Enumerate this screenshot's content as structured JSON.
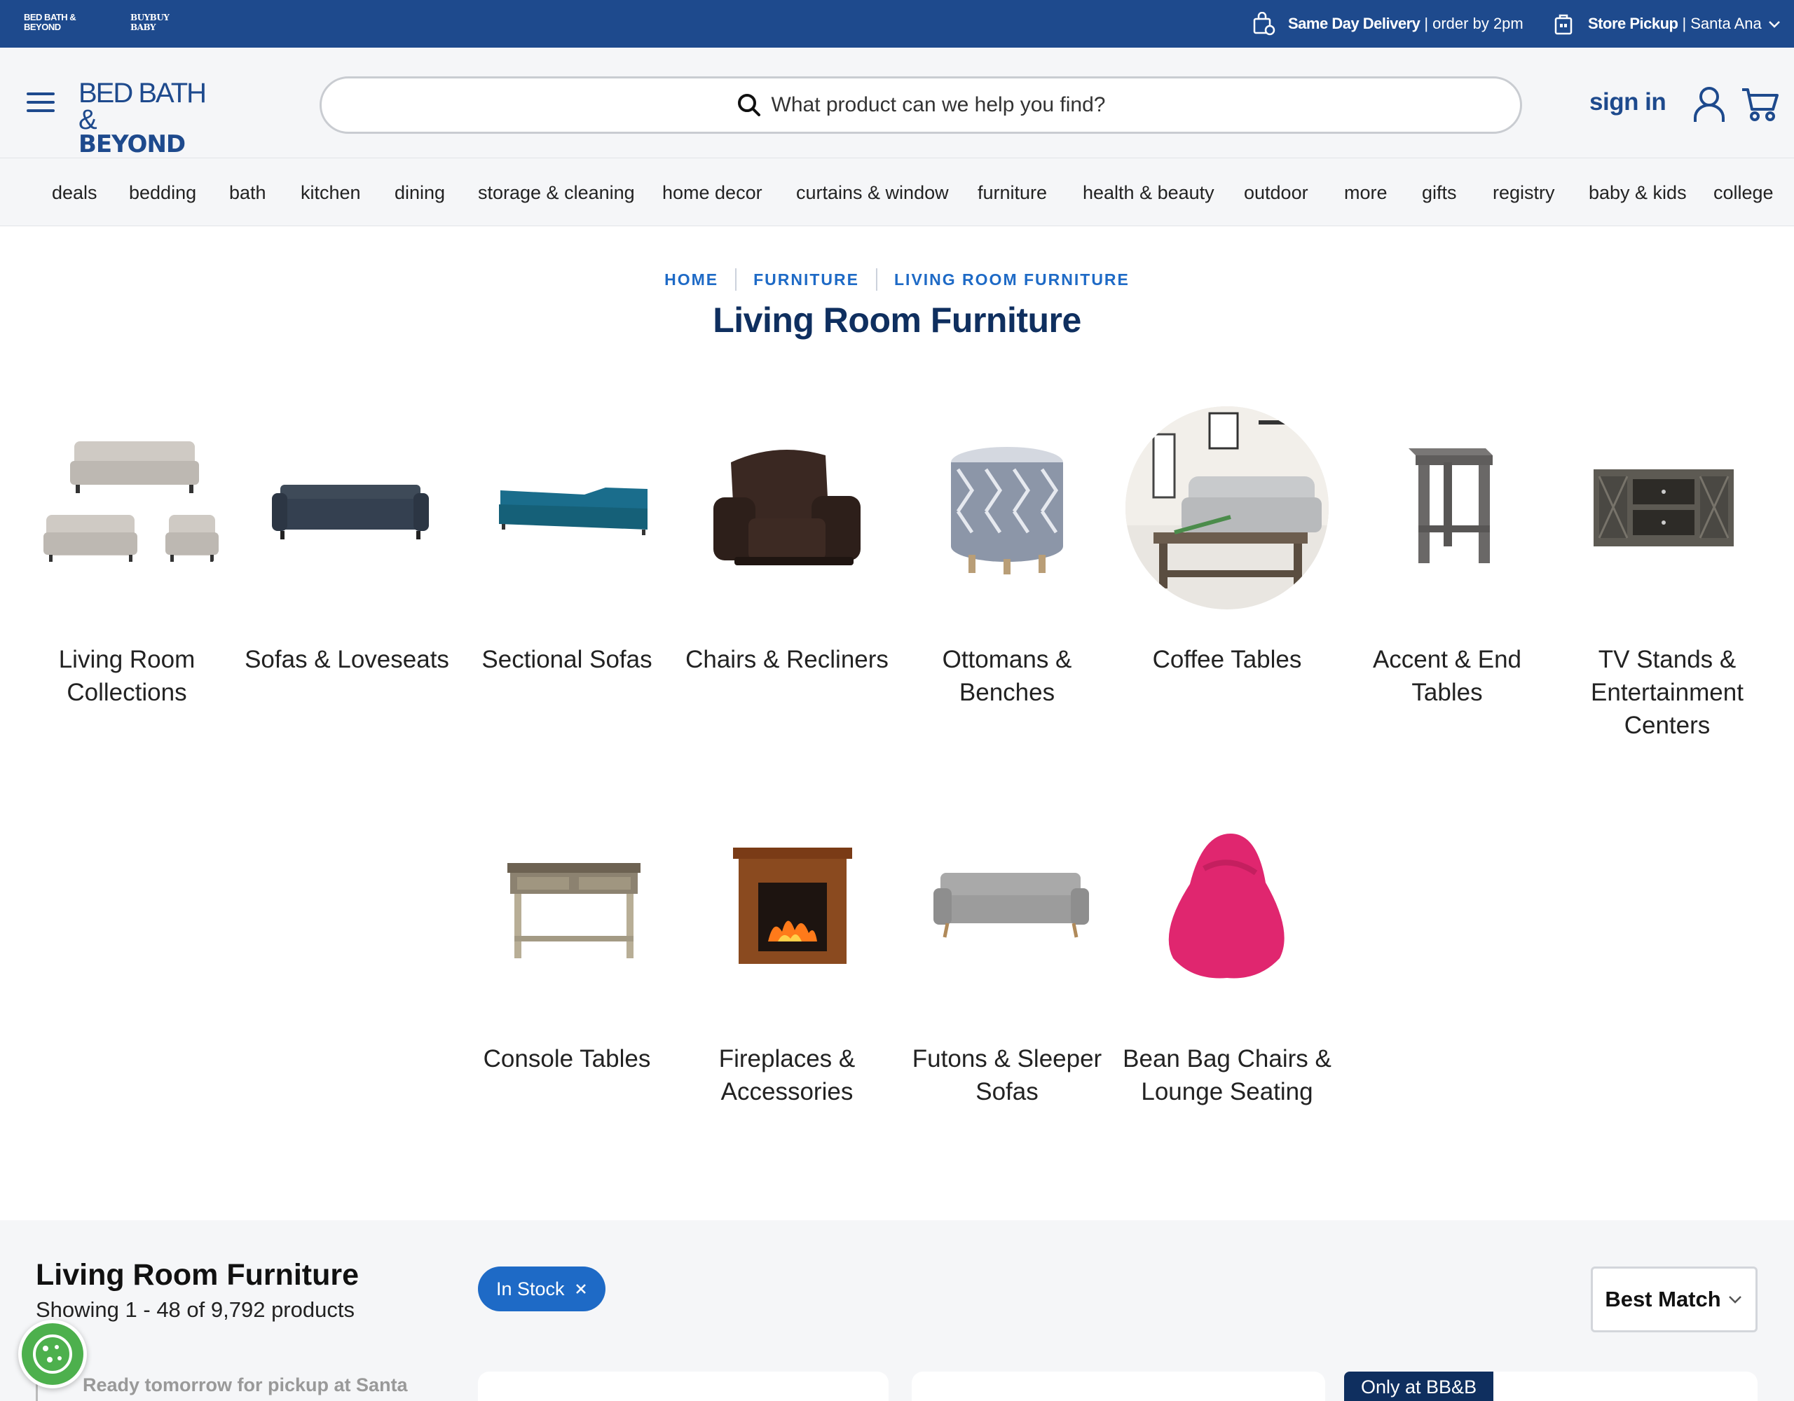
{
  "topbar": {
    "brand_bbb": "BED BATH & BEYOND",
    "brand_baby": "buybuy BABY",
    "delivery_bold": "Same Day Delivery",
    "delivery_rest": "order by 2pm",
    "pickup_bold": "Store Pickup",
    "pickup_rest": "Santa Ana",
    "separator": "|"
  },
  "header": {
    "logo_line1": "BED BATH &",
    "logo_line2": "BEYOND",
    "search_placeholder": "What product can we help you find?",
    "signin_label": "sign in"
  },
  "nav": {
    "items": [
      "deals",
      "bedding",
      "bath",
      "kitchen",
      "dining",
      "storage & cleaning",
      "home decor",
      "curtains & window",
      "furniture",
      "health & beauty",
      "outdoor",
      "more",
      "gifts",
      "registry",
      "baby & kids",
      "college"
    ]
  },
  "breadcrumb": {
    "items": [
      "HOME",
      "FURNITURE",
      "LIVING ROOM FURNITURE"
    ]
  },
  "page_title": "Living Room Furniture",
  "categories": [
    {
      "label": "Living Room Collections",
      "icon": "sofa-set-icon"
    },
    {
      "label": "Sofas & Loveseats",
      "icon": "sofa-icon"
    },
    {
      "label": "Sectional Sofas",
      "icon": "sectional-sofa-icon"
    },
    {
      "label": "Chairs & Recliners",
      "icon": "recliner-icon"
    },
    {
      "label": "Ottomans & Benches",
      "icon": "ottoman-icon"
    },
    {
      "label": "Coffee Tables",
      "icon": "coffee-table-icon"
    },
    {
      "label": "Accent & End Tables",
      "icon": "end-table-icon"
    },
    {
      "label": "TV Stands & Entertainment Centers",
      "icon": "tv-stand-icon"
    },
    {
      "label": "Console Tables",
      "icon": "console-table-icon"
    },
    {
      "label": "Fireplaces & Accessories",
      "icon": "fireplace-icon"
    },
    {
      "label": "Futons & Sleeper Sofas",
      "icon": "futon-icon"
    },
    {
      "label": "Bean Bag Chairs & Lounge Seating",
      "icon": "bean-bag-icon"
    }
  ],
  "listing": {
    "title": "Living Room Furniture",
    "count": "Showing 1 - 48 of 9,792 products",
    "filter_chip": "In Stock",
    "sort_label": "Best Match",
    "pickup_text": "Ready tomorrow for pickup at Santa",
    "badge": "Only at BB&B"
  },
  "colors": {
    "topbar": "#1e4a8d",
    "brand_blue": "#1e4a8d",
    "link_blue": "#1e6ac6",
    "title_navy": "#0f2f5f",
    "page_bg_gray": "#f5f6f8",
    "cookie_green": "#4db04d"
  }
}
